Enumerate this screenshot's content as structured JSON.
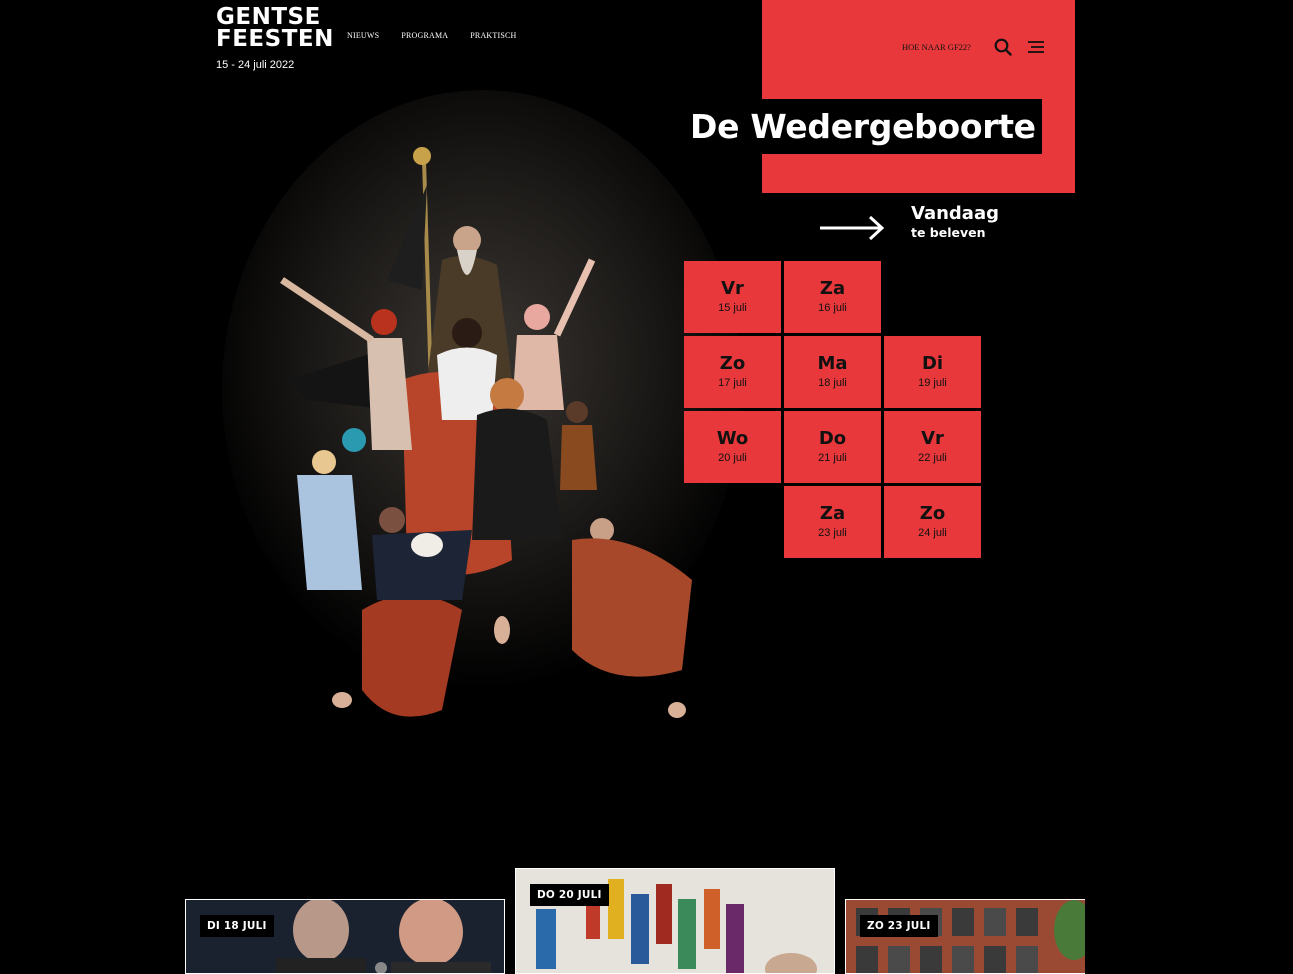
{
  "header": {
    "logo_line1": "GENTSE",
    "logo_line2": "FEESTEN",
    "dates": "15 - 24 juli 2022",
    "nav": [
      "NIEUWS",
      "PROGRAMA",
      "PRAKTISCH"
    ],
    "hoe_naar": "HOE NAAR GF22?"
  },
  "hero": {
    "title": "De Wedergeboorte"
  },
  "today": {
    "line1": "Vandaag",
    "line2": "te beleven"
  },
  "days": [
    {
      "name": "Vr",
      "date": "15 juli"
    },
    {
      "name": "Za",
      "date": "16 juli"
    },
    {
      "name": "Zo",
      "date": "17 juli"
    },
    {
      "name": "Ma",
      "date": "18 juli"
    },
    {
      "name": "Di",
      "date": "19 juli"
    },
    {
      "name": "Wo",
      "date": "20 juli"
    },
    {
      "name": "Do",
      "date": "21 juli"
    },
    {
      "name": "Vr",
      "date": "22 juli"
    },
    {
      "name": "Za",
      "date": "23 juli"
    },
    {
      "name": "Zo",
      "date": "24 juli"
    }
  ],
  "cards": [
    {
      "badge": "DI 18 JULI"
    },
    {
      "badge": "DO 20 JULI"
    },
    {
      "badge": "ZO 23 JULI"
    }
  ],
  "colors": {
    "accent": "#e8383b",
    "background": "#000000"
  }
}
